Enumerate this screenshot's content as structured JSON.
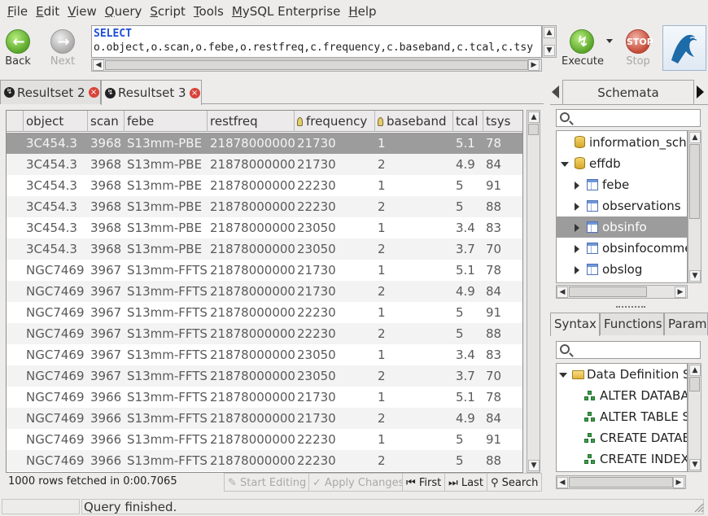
{
  "menu": [
    "File",
    "Edit",
    "View",
    "Query",
    "Script",
    "Tools",
    "MySQL Enterprise",
    "Help"
  ],
  "toolbar": {
    "back_label": "Back",
    "next_label": "Next",
    "execute_label": "Execute",
    "stop_label": "Stop"
  },
  "sql": {
    "keyword": "SELECT",
    "line2": "o.object,o.scan,o.febe,o.restfreq,c.frequency,c.baseband,c.tcal,c.tsy"
  },
  "result_tabs": [
    {
      "label": "Resultset 2"
    },
    {
      "label": "Resultset 3"
    }
  ],
  "columns": [
    "object",
    "scan",
    "febe",
    "restfreq",
    "frequency",
    "baseband",
    "tcal",
    "tsys"
  ],
  "rows": [
    [
      "3C454.3",
      "3968",
      "S13mm-PBE",
      "21878000000",
      "21730",
      "1",
      "5.1",
      "78"
    ],
    [
      "3C454.3",
      "3968",
      "S13mm-PBE",
      "21878000000",
      "21730",
      "2",
      "4.9",
      "84"
    ],
    [
      "3C454.3",
      "3968",
      "S13mm-PBE",
      "21878000000",
      "22230",
      "1",
      "5",
      "91"
    ],
    [
      "3C454.3",
      "3968",
      "S13mm-PBE",
      "21878000000",
      "22230",
      "2",
      "5",
      "88"
    ],
    [
      "3C454.3",
      "3968",
      "S13mm-PBE",
      "21878000000",
      "23050",
      "1",
      "3.4",
      "83"
    ],
    [
      "3C454.3",
      "3968",
      "S13mm-PBE",
      "21878000000",
      "23050",
      "2",
      "3.7",
      "70"
    ],
    [
      "NGC7469",
      "3967",
      "S13mm-FFTS",
      "21878000000",
      "21730",
      "1",
      "5.1",
      "78"
    ],
    [
      "NGC7469",
      "3967",
      "S13mm-FFTS",
      "21878000000",
      "21730",
      "2",
      "4.9",
      "84"
    ],
    [
      "NGC7469",
      "3967",
      "S13mm-FFTS",
      "21878000000",
      "22230",
      "1",
      "5",
      "91"
    ],
    [
      "NGC7469",
      "3967",
      "S13mm-FFTS",
      "21878000000",
      "22230",
      "2",
      "5",
      "88"
    ],
    [
      "NGC7469",
      "3967",
      "S13mm-FFTS",
      "21878000000",
      "23050",
      "1",
      "3.4",
      "83"
    ],
    [
      "NGC7469",
      "3967",
      "S13mm-FFTS",
      "21878000000",
      "23050",
      "2",
      "3.7",
      "70"
    ],
    [
      "NGC7469",
      "3966",
      "S13mm-FFTS",
      "21878000000",
      "21730",
      "1",
      "5.1",
      "78"
    ],
    [
      "NGC7469",
      "3966",
      "S13mm-FFTS",
      "21878000000",
      "21730",
      "2",
      "4.9",
      "84"
    ],
    [
      "NGC7469",
      "3966",
      "S13mm-FFTS",
      "21878000000",
      "22230",
      "1",
      "5",
      "91"
    ],
    [
      "NGC7469",
      "3966",
      "S13mm-FFTS",
      "21878000000",
      "22230",
      "2",
      "5",
      "88"
    ]
  ],
  "grid_footer": {
    "rows_fetched": "1000 rows fetched in 0:00.7065",
    "start_editing": "Start Editing",
    "apply_changes": "Apply Changes",
    "first": "First",
    "last": "Last",
    "search": "Search"
  },
  "schemata": {
    "tab_label": "Schemata",
    "items": [
      {
        "label": "information_sche"
      },
      {
        "label": "effdb"
      },
      {
        "label": "febe"
      },
      {
        "label": "observations"
      },
      {
        "label": "obsinfo"
      },
      {
        "label": "obsinfocomme"
      },
      {
        "label": "obslog"
      }
    ]
  },
  "syntax": {
    "tabs": [
      "Syntax",
      "Functions",
      "Params"
    ],
    "folder": "Data Definition S",
    "items": [
      "ALTER DATABA",
      "ALTER TABLE S",
      "CREATE DATAE",
      "CREATE INDEX"
    ]
  },
  "status": {
    "text": "Query finished."
  }
}
